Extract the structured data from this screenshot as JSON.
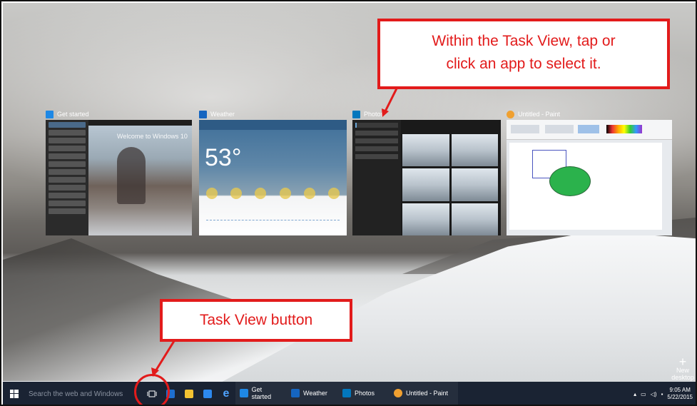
{
  "annotations": {
    "select_app": "Within the Task View, tap or click an app to select it.",
    "select_app_line1": "Within the Task View, tap or",
    "select_app_line2": "click an app to select it.",
    "task_view_button": "Task View button"
  },
  "task_view": {
    "windows": [
      {
        "title": "Get started",
        "icon": "get-started-icon",
        "icon_color": "#1e88e5",
        "inner_text": "Welcome to Windows 10"
      },
      {
        "title": "Weather",
        "icon": "weather-icon",
        "icon_color": "#1565c0",
        "temp": "53°"
      },
      {
        "title": "Photos",
        "icon": "photos-icon",
        "icon_color": "#0277bd"
      },
      {
        "title": "Untitled - Paint",
        "icon": "paint-icon",
        "icon_color": "#f0a030"
      }
    ],
    "new_desktop_label": "New desktop"
  },
  "taskbar": {
    "search_placeholder": "Search the web and Windows",
    "apps": [
      {
        "label": "Get started",
        "icon": "get-started-icon"
      },
      {
        "label": "Weather",
        "icon": "weather-icon"
      },
      {
        "label": "Photos",
        "icon": "photos-icon"
      },
      {
        "label": "Untitled - Paint",
        "icon": "paint-icon"
      }
    ],
    "clock_time": "9:05 AM",
    "clock_date": "5/22/2015"
  },
  "colors": {
    "callout_red": "#e21b1b",
    "taskbar_bg": "#1a2333"
  }
}
